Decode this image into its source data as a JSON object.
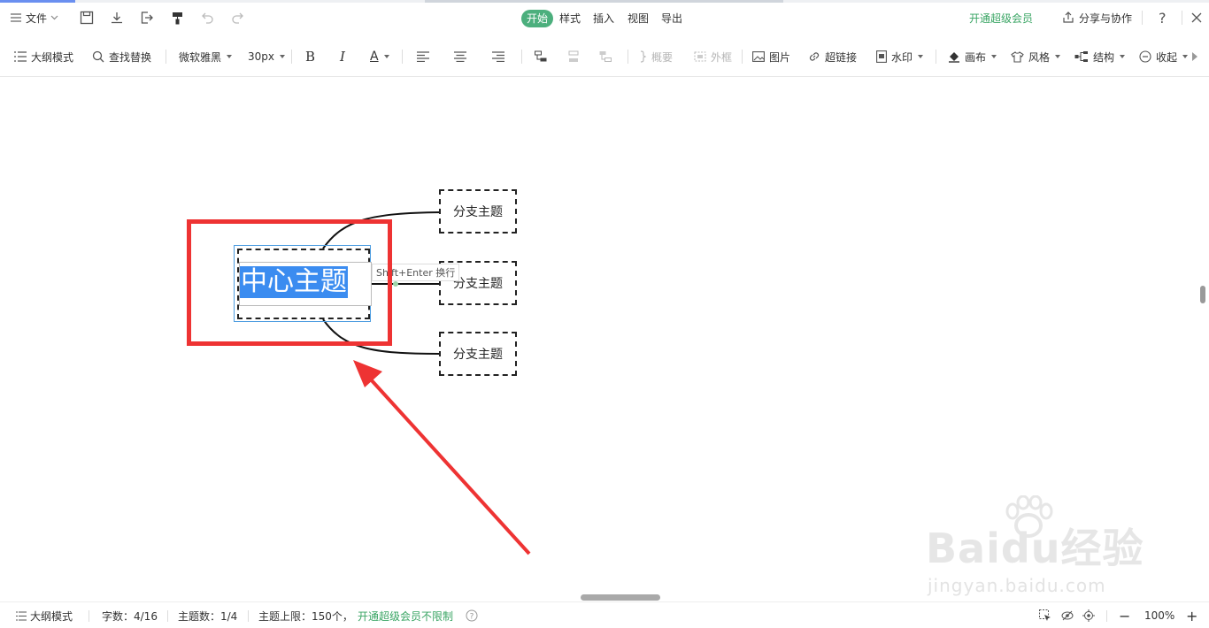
{
  "menubar": {
    "file_label": "文件",
    "tabs": [
      {
        "label": "开始",
        "active": true
      },
      {
        "label": "样式",
        "active": false
      },
      {
        "label": "插入",
        "active": false
      },
      {
        "label": "视图",
        "active": false
      },
      {
        "label": "导出",
        "active": false
      }
    ],
    "vip_label": "开通超级会员",
    "share_label": "分享与协作",
    "help_label": "?"
  },
  "toolbar": {
    "outline_mode": "大纲模式",
    "find_replace": "查找替换",
    "font_family": "微软雅黑",
    "font_size": "30px",
    "bold": "B",
    "italic": "I",
    "font_color": "A",
    "summary": "概要",
    "frame": "外框",
    "image": "图片",
    "hyperlink": "超链接",
    "watermark": "水印",
    "canvas": "画布",
    "style": "风格",
    "structure": "结构",
    "collapse": "收起"
  },
  "mindmap": {
    "central_topic": "中心主题",
    "branches": [
      "分支主题",
      "分支主题",
      "分支主题"
    ],
    "hint": "Shift+Enter 换行"
  },
  "watermark": {
    "brand": "Baidu经验",
    "url": "jingyan.baidu.com"
  },
  "statusbar": {
    "outline_mode": "大纲模式",
    "word_count": "字数：4/16",
    "topic_count": "主题数：1/4",
    "topic_limit": "主题上限：150个，",
    "vip_unlimited": "开通超级会员不限制",
    "zoom": "100%",
    "zoom_out": "−",
    "zoom_in": "+"
  },
  "colors": {
    "accent_green": "#4caf7d",
    "selection_blue": "#3b8cf0",
    "annotation_red": "#ee3333"
  }
}
